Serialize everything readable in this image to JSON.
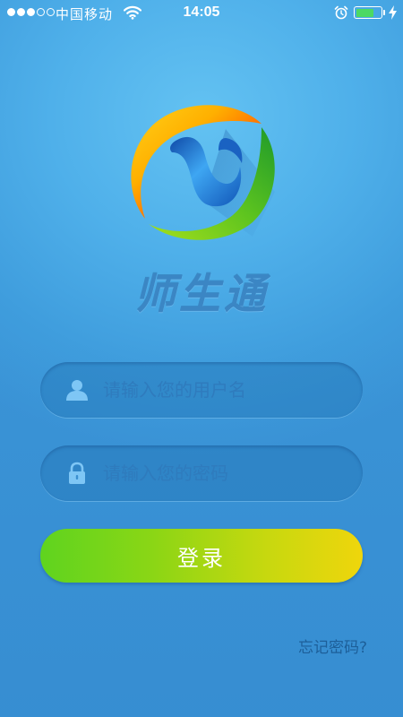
{
  "status_bar": {
    "signal_strength": 3,
    "signal_max": 5,
    "carrier": "中国移动",
    "time": "14:05",
    "battery_level": 0.75,
    "battery_color": "#4cd964",
    "icons": [
      "signal-dots-icon",
      "wifi-icon",
      "alarm-icon",
      "battery-icon",
      "charging-icon"
    ]
  },
  "app": {
    "title": "师生通",
    "logo_icon": "app-logo-icon"
  },
  "login_form": {
    "username": {
      "placeholder": "请输入您的用户名",
      "value": "",
      "icon": "user-icon"
    },
    "password": {
      "placeholder": "请输入您的密码",
      "value": "",
      "icon": "lock-icon"
    },
    "submit_label": "登录",
    "forgot_password_label": "忘记密码?"
  },
  "colors": {
    "background": "#4fb0ea",
    "button_gradient_start": "#5fd41f",
    "button_gradient_end": "#efd60c",
    "title": "#3b86c4",
    "placeholder": "#2f7bbd",
    "link": "#1d5f99"
  }
}
